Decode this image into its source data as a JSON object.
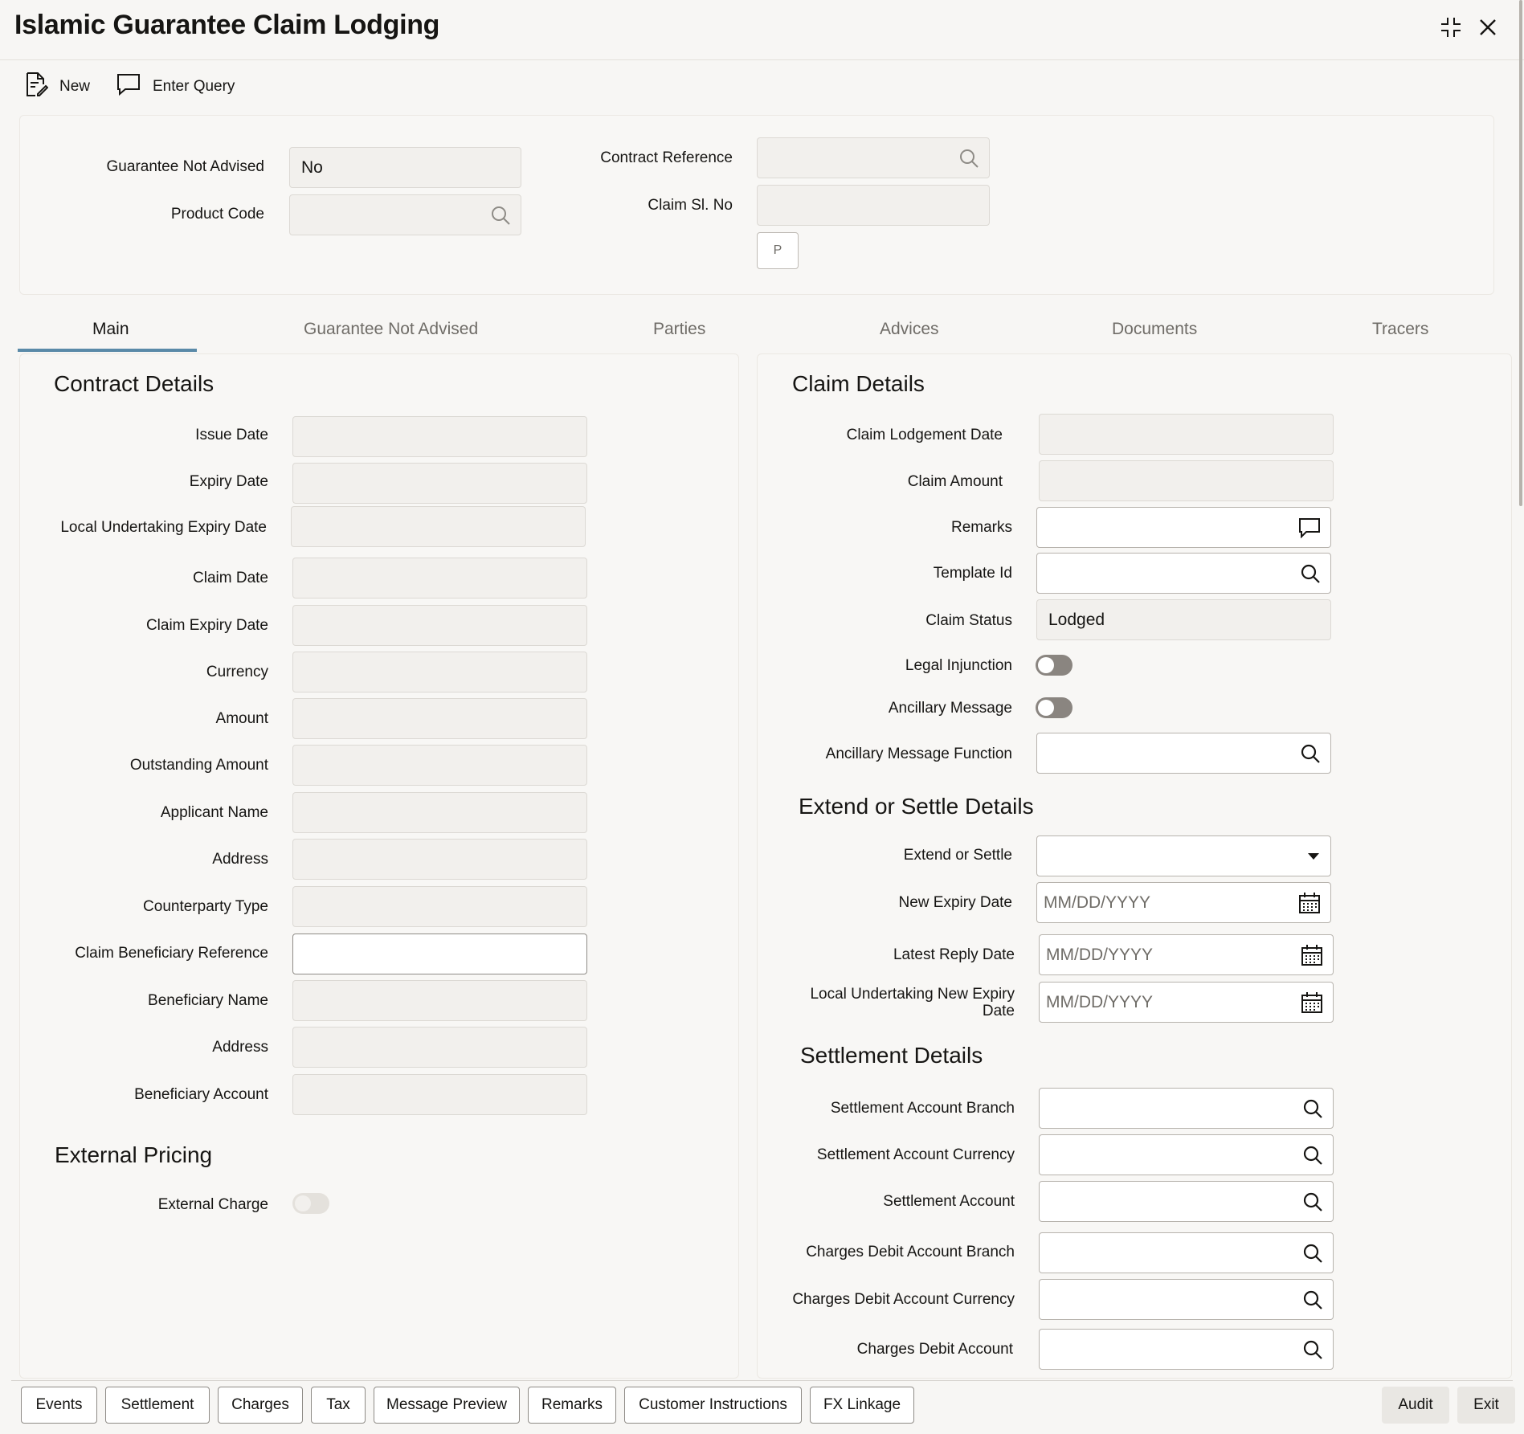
{
  "window": {
    "title": "Islamic Guarantee Claim Lodging"
  },
  "toolbar": {
    "new_label": "New",
    "enter_query_label": "Enter Query"
  },
  "header": {
    "guarantee_not_advised_label": "Guarantee Not Advised",
    "guarantee_not_advised_value": "No",
    "product_code_label": "Product Code",
    "contract_reference_label": "Contract Reference",
    "claim_sl_no_label": "Claim Sl. No",
    "p_button_label": "P"
  },
  "tabs": [
    {
      "label": "Main"
    },
    {
      "label": "Guarantee Not Advised"
    },
    {
      "label": "Parties"
    },
    {
      "label": "Advices"
    },
    {
      "label": "Documents"
    },
    {
      "label": "Tracers"
    }
  ],
  "contract_details": {
    "title": "Contract Details",
    "fields": [
      {
        "label": "Issue Date"
      },
      {
        "label": "Expiry Date"
      },
      {
        "label": "Local Undertaking Expiry Date"
      },
      {
        "label": "Claim Date"
      },
      {
        "label": "Claim Expiry Date"
      },
      {
        "label": "Currency"
      },
      {
        "label": "Amount"
      },
      {
        "label": "Outstanding Amount"
      },
      {
        "label": "Applicant Name"
      },
      {
        "label": "Address"
      },
      {
        "label": "Counterparty Type"
      },
      {
        "label": "Claim Beneficiary Reference"
      },
      {
        "label": "Beneficiary Name"
      },
      {
        "label": "Address"
      },
      {
        "label": "Beneficiary Account"
      }
    ]
  },
  "external_pricing": {
    "title": "External Pricing",
    "external_charge_label": "External Charge"
  },
  "claim_details": {
    "title": "Claim Details",
    "claim_lodgement_date_label": "Claim Lodgement Date",
    "claim_amount_label": "Claim Amount",
    "remarks_label": "Remarks",
    "template_id_label": "Template Id",
    "claim_status_label": "Claim Status",
    "claim_status_value": "Lodged",
    "legal_injunction_label": "Legal Injunction",
    "ancillary_message_label": "Ancillary Message",
    "ancillary_message_function_label": "Ancillary Message Function"
  },
  "extend_settle": {
    "title": "Extend or Settle Details",
    "extend_or_settle_label": "Extend or Settle",
    "new_expiry_date_label": "New Expiry Date",
    "latest_reply_date_label": "Latest Reply Date",
    "local_new_expiry_label_1": "Local Undertaking New Expiry",
    "local_new_expiry_label_2": "Date",
    "date_placeholder": "MM/DD/YYYY"
  },
  "settlement_details": {
    "title": "Settlement Details",
    "fields": [
      {
        "label": "Settlement Account Branch"
      },
      {
        "label": "Settlement Account Currency"
      },
      {
        "label": "Settlement Account"
      },
      {
        "label": "Charges Debit Account Branch"
      },
      {
        "label": "Charges Debit Account Currency"
      },
      {
        "label": "Charges Debit Account"
      }
    ]
  },
  "footer": {
    "buttons": [
      {
        "label": "Events"
      },
      {
        "label": "Settlement"
      },
      {
        "label": "Charges"
      },
      {
        "label": "Tax"
      },
      {
        "label": "Message Preview"
      },
      {
        "label": "Remarks"
      },
      {
        "label": "Customer Instructions"
      },
      {
        "label": "FX Linkage"
      }
    ],
    "audit_label": "Audit",
    "exit_label": "Exit"
  },
  "colors": {
    "tab_accent": "#5a8aa8",
    "text": "#161513",
    "muted": "#6f6c67",
    "toggle_off": "#8a8580"
  }
}
